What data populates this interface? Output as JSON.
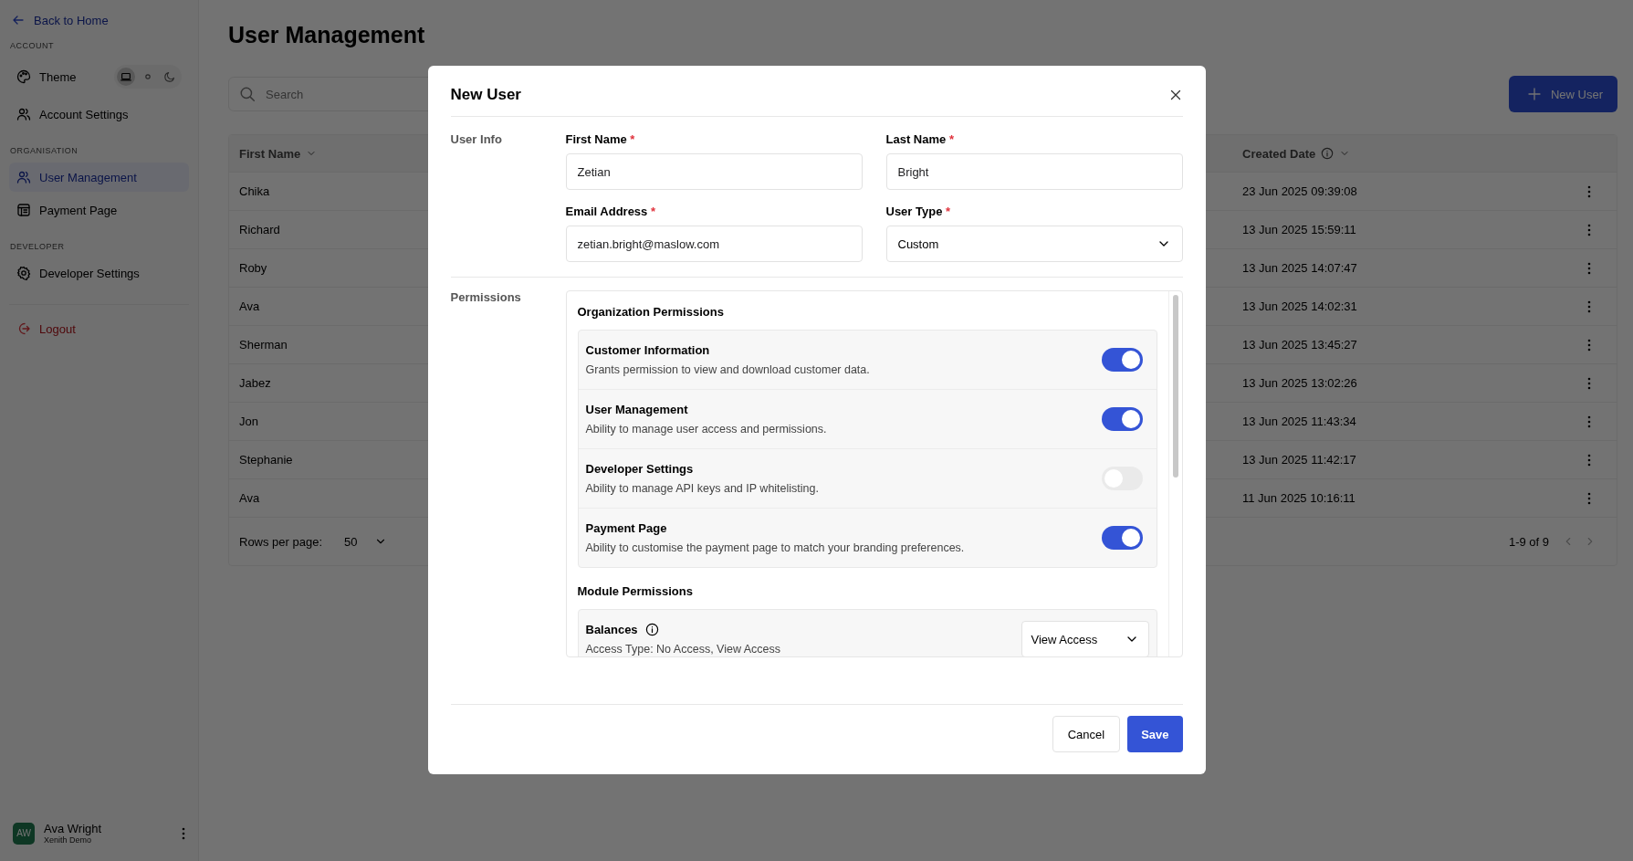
{
  "sidebar": {
    "back_link": "Back to Home",
    "sections": [
      {
        "heading": "ACCOUNT",
        "items": [
          {
            "label": "Theme",
            "selected": false,
            "kind": "theme"
          },
          {
            "label": "Account Settings",
            "selected": false,
            "kind": "link"
          }
        ]
      },
      {
        "heading": "ORGANISATION",
        "items": [
          {
            "label": "User Management",
            "selected": true,
            "kind": "link"
          },
          {
            "label": "Payment Page",
            "selected": false,
            "kind": "link"
          }
        ]
      },
      {
        "heading": "DEVELOPER",
        "items": [
          {
            "label": "Developer Settings",
            "selected": false,
            "kind": "link"
          }
        ]
      }
    ],
    "theme_options": [
      {
        "selected": true
      },
      {
        "selected": false
      },
      {
        "selected": false
      }
    ],
    "logout": "Logout",
    "user": {
      "initials": "AW",
      "name": "Ava Wright",
      "org": "Xenith Demo"
    }
  },
  "main": {
    "title": "User Management",
    "search": {
      "placeholder": "Search"
    },
    "new_user_button": "New User",
    "table": {
      "columns": [
        {
          "label": "First Name",
          "kind": "sort"
        },
        {
          "label": "Created Date",
          "kind": "info-sort"
        }
      ],
      "rows": [
        {
          "first_name": "Chika",
          "created_date": "23 Jun 2025 09:39:08"
        },
        {
          "first_name": "Richard",
          "created_date": "13 Jun 2025 15:59:11"
        },
        {
          "first_name": "Roby",
          "created_date": "13 Jun 2025 14:07:47"
        },
        {
          "first_name": "Ava",
          "created_date": "13 Jun 2025 14:02:31"
        },
        {
          "first_name": "Sherman",
          "created_date": "13 Jun 2025 13:45:27"
        },
        {
          "first_name": "Jabez",
          "created_date": "13 Jun 2025 13:02:26"
        },
        {
          "first_name": "Jon",
          "created_date": "13 Jun 2025 11:43:34"
        },
        {
          "first_name": "Stephanie",
          "created_date": "13 Jun 2025 11:42:17"
        },
        {
          "first_name": "Ava",
          "created_date": "11 Jun 2025 10:16:11"
        }
      ]
    },
    "pagination": {
      "rows_per_page_label": "Rows per page:",
      "rows_per_page": "50",
      "range": "1-9 of 9"
    }
  },
  "modal": {
    "title": "New User",
    "user_info_label": "User Info",
    "fields": [
      {
        "label": "First Name",
        "required_mark": "*",
        "value": "Zetian",
        "kind": "text"
      },
      {
        "label": "Last Name",
        "required_mark": "*",
        "value": "Bright",
        "kind": "text"
      },
      {
        "label": "Email Address",
        "required_mark": "*",
        "value": "zetian.bright@maslow.com",
        "kind": "text"
      },
      {
        "label": "User Type",
        "required_mark": "*",
        "value": "Custom",
        "kind": "select"
      }
    ],
    "permissions_label": "Permissions",
    "permission_groups": [
      {
        "title": "Organization Permissions",
        "items": [
          {
            "kind": "toggle",
            "name": "Customer Information",
            "description": "Grants permission to view and download customer data.",
            "on": true
          },
          {
            "kind": "toggle",
            "name": "User Management",
            "description": "Ability to manage user access and permissions.",
            "on": true
          },
          {
            "kind": "toggle",
            "name": "Developer Settings",
            "description": "Ability to manage API keys and IP whitelisting.",
            "on": false
          },
          {
            "kind": "toggle",
            "name": "Payment Page",
            "description": "Ability to customise the payment page to match your branding preferences.",
            "on": true
          }
        ]
      },
      {
        "title": "Module Permissions",
        "items": [
          {
            "kind": "select",
            "name": "Balances",
            "description": "Access Type: No Access, View Access",
            "value": "View Access"
          }
        ]
      }
    ],
    "cancel_button": "Cancel",
    "save_button": "Save"
  }
}
